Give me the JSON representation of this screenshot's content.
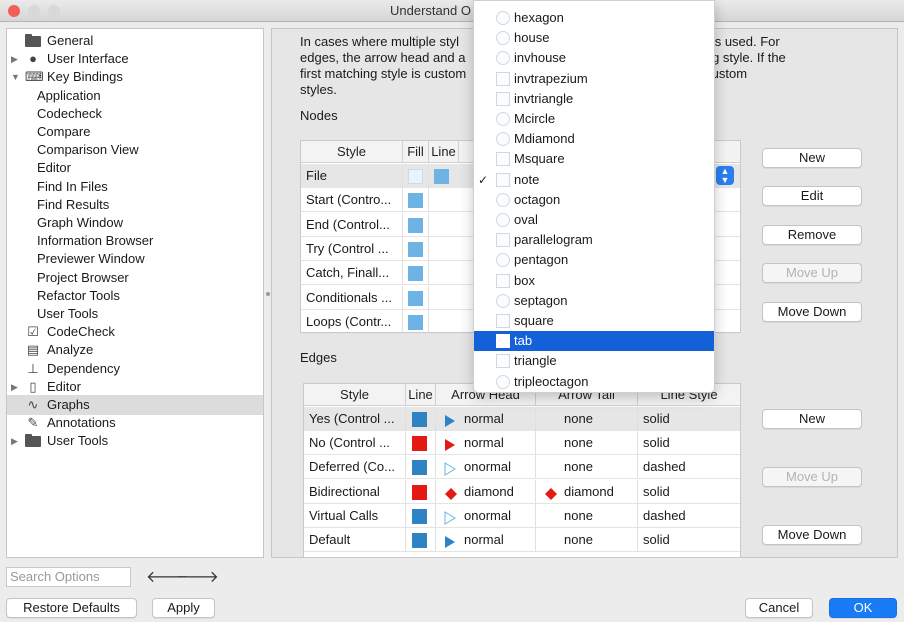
{
  "window": {
    "title": "Understand O"
  },
  "tree": [
    {
      "label": "General",
      "icon": "folder-icon",
      "glyph": "folder",
      "level": 0,
      "arrow": ""
    },
    {
      "label": "User Interface",
      "icon": "user-icon",
      "glyph": "●",
      "level": 0,
      "arrow": "▶"
    },
    {
      "label": "Key Bindings",
      "icon": "keyboard-icon",
      "glyph": "⌨",
      "level": 0,
      "arrow": "▼"
    },
    {
      "label": "Application",
      "level": 1
    },
    {
      "label": "Codecheck",
      "level": 1
    },
    {
      "label": "Compare",
      "level": 1
    },
    {
      "label": "Comparison View",
      "level": 1
    },
    {
      "label": "Editor",
      "level": 1
    },
    {
      "label": "Find In Files",
      "level": 1
    },
    {
      "label": "Find Results",
      "level": 1
    },
    {
      "label": "Graph Window",
      "level": 1
    },
    {
      "label": "Information Browser",
      "level": 1
    },
    {
      "label": "Previewer Window",
      "level": 1
    },
    {
      "label": "Project Browser",
      "level": 1
    },
    {
      "label": "Refactor Tools",
      "level": 1
    },
    {
      "label": "User Tools",
      "level": 1
    },
    {
      "label": "CodeCheck",
      "icon": "checklist-icon",
      "glyph": "☑",
      "level": 0,
      "arrow": ""
    },
    {
      "label": "Analyze",
      "icon": "analyze-icon",
      "glyph": "▤",
      "level": 0,
      "arrow": ""
    },
    {
      "label": "Dependency",
      "icon": "dependency-icon",
      "glyph": "⊥",
      "level": 0,
      "arrow": ""
    },
    {
      "label": "Editor",
      "icon": "document-icon",
      "glyph": "▯",
      "level": 0,
      "arrow": "▶"
    },
    {
      "label": "Graphs",
      "icon": "graph-icon",
      "glyph": "∿",
      "level": 0,
      "arrow": "",
      "selected": true
    },
    {
      "label": "Annotations",
      "icon": "pencil-icon",
      "glyph": "✎",
      "level": 0,
      "arrow": ""
    },
    {
      "label": "User Tools",
      "icon": "folder-icon",
      "glyph": "folder",
      "level": 0,
      "arrow": "▶"
    }
  ],
  "description": {
    "line1": "In cases where multiple styl",
    "line1b": "atching style is used. For",
    "line2": "edges, the arrow head and a",
    "line2b": "rst matching style. If the",
    "line3": "first matching style is custom",
    "line3b": "all matching custom",
    "line4": "styles."
  },
  "nodes": {
    "label": "Nodes",
    "headers": [
      "Style",
      "Fill",
      "Line"
    ],
    "rows": [
      {
        "style": "File",
        "fill": "ghost",
        "line": "lblue"
      },
      {
        "style": "Start (Contro...",
        "fill": "lblue",
        "line": ""
      },
      {
        "style": "End (Control...",
        "fill": "lblue",
        "line": ""
      },
      {
        "style": "Try (Control ...",
        "fill": "lblue",
        "line": ""
      },
      {
        "style": "Catch, Finall...",
        "fill": "lblue",
        "line": ""
      },
      {
        "style": "Conditionals ...",
        "fill": "lblue",
        "line": ""
      },
      {
        "style": "Loops (Contr...",
        "fill": "lblue",
        "line": ""
      }
    ],
    "buttons": {
      "new": "New",
      "edit": "Edit",
      "remove": "Remove",
      "move_up": "Move Up",
      "move_down": "Move Down"
    }
  },
  "edges": {
    "label": "Edges",
    "headers": [
      "Style",
      "Line",
      "Arrow Head",
      "Arrow Tail",
      "Line Style"
    ],
    "rows": [
      {
        "style": "Yes (Control ...",
        "color": "blue",
        "head_icon": "filled-triangle",
        "head_color": "#2f83c2",
        "head": "normal",
        "tail": "none",
        "line_style": "solid"
      },
      {
        "style": "No (Control ...",
        "color": "red",
        "head_icon": "filled-triangle",
        "head_color": "#e31b12",
        "head": "normal",
        "tail": "none",
        "line_style": "solid"
      },
      {
        "style": "Deferred (Co...",
        "color": "blue",
        "head_icon": "open-triangle",
        "head_color": "#6db3e3",
        "head": "onormal",
        "tail": "none",
        "line_style": "dashed"
      },
      {
        "style": "Bidirectional",
        "color": "red",
        "head_icon": "diamond",
        "head_color": "#e31b12",
        "head": "diamond",
        "tail": "diamond",
        "tail_icon": "diamond",
        "line_style": "solid"
      },
      {
        "style": "Virtual Calls",
        "color": "blue",
        "head_icon": "open-triangle",
        "head_color": "#6db3e3",
        "head": "onormal",
        "tail": "none",
        "line_style": "dashed"
      },
      {
        "style": "Default",
        "color": "blue",
        "head_icon": "filled-triangle",
        "head_color": "#2f83c2",
        "head": "normal",
        "tail": "none",
        "line_style": "solid"
      }
    ],
    "buttons": {
      "new": "New",
      "move_up": "Move Up",
      "move_down": "Move Down"
    }
  },
  "dropdown": {
    "items": [
      {
        "label": "hexagon"
      },
      {
        "label": "house"
      },
      {
        "label": "invhouse"
      },
      {
        "label": "invtrapezium"
      },
      {
        "label": "invtriangle"
      },
      {
        "label": "Mcircle"
      },
      {
        "label": "Mdiamond"
      },
      {
        "label": "Msquare"
      },
      {
        "label": "note",
        "checked": true
      },
      {
        "label": "octagon"
      },
      {
        "label": "oval"
      },
      {
        "label": "parallelogram"
      },
      {
        "label": "pentagon"
      },
      {
        "label": "box"
      },
      {
        "label": "septagon"
      },
      {
        "label": "square"
      },
      {
        "label": "tab",
        "highlighted": true
      },
      {
        "label": "triangle"
      },
      {
        "label": "tripleoctagon"
      }
    ],
    "check_glyph": "✓"
  },
  "footer": {
    "search_placeholder": "Search Options",
    "restore": "Restore Defaults",
    "apply": "Apply",
    "cancel": "Cancel",
    "ok": "OK"
  },
  "colors": {
    "accent": "#1a7cf5",
    "selection": "#1360d9"
  }
}
